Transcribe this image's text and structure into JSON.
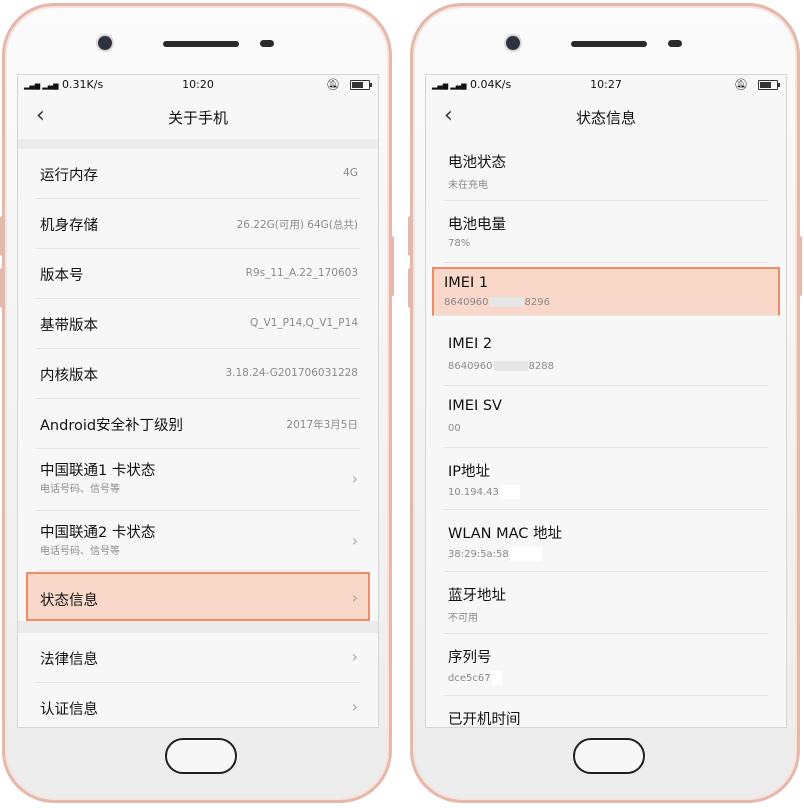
{
  "left": {
    "status": {
      "net": "0.31K/s",
      "time": "10:20"
    },
    "title": "关于手机",
    "rows": [
      {
        "label": "运行内存",
        "value": "4G"
      },
      {
        "label": "机身存储",
        "value": "26.22G(可用)  64G(总共)"
      },
      {
        "label": "版本号",
        "value": "R9s_11_A.22_170603"
      },
      {
        "label": "基带版本",
        "value": "Q_V1_P14,Q_V1_P14"
      },
      {
        "label": "内核版本",
        "value": "3.18.24-G201706031228"
      },
      {
        "label": "Android安全补丁级别",
        "value": "2017年3月5日"
      },
      {
        "label": "中国联通1 卡状态",
        "sub": "电话号码、信号等"
      },
      {
        "label": "中国联通2 卡状态",
        "sub": "电话号码、信号等"
      },
      {
        "label": "状态信息"
      }
    ],
    "rows2": [
      {
        "label": "法律信息"
      },
      {
        "label": "认证信息"
      }
    ]
  },
  "right": {
    "status": {
      "net": "0.04K/s",
      "time": "10:27"
    },
    "title": "状态信息",
    "rows": [
      {
        "label": "电池状态",
        "sub": "未在充电"
      },
      {
        "label": "电池电量",
        "sub": "78%"
      },
      {
        "label": "IMEI 1",
        "sub_a": "8640960",
        "sub_b": "8296"
      },
      {
        "label": "IMEI 2",
        "sub_a": "8640960",
        "sub_b": "8288"
      },
      {
        "label": "IMEI SV",
        "sub": "00"
      },
      {
        "label": "IP地址",
        "sub": "10.194.43"
      },
      {
        "label": "WLAN MAC 地址",
        "sub": "38:29:5a:58"
      },
      {
        "label": "蓝牙地址",
        "sub": "不可用"
      },
      {
        "label": "序列号",
        "sub": "dce5c67"
      },
      {
        "label": "已开机时间"
      }
    ]
  },
  "status_signal": "4G 4G",
  "colors": {
    "highlight_fill": "#f9d8ca",
    "highlight_border": "#ef8c67",
    "phone_frame": "#e4b8aa"
  },
  "icons": [
    "back-arrow-icon",
    "chevron-right-icon",
    "battery-icon",
    "silent-bell-icon",
    "signal-icon"
  ]
}
